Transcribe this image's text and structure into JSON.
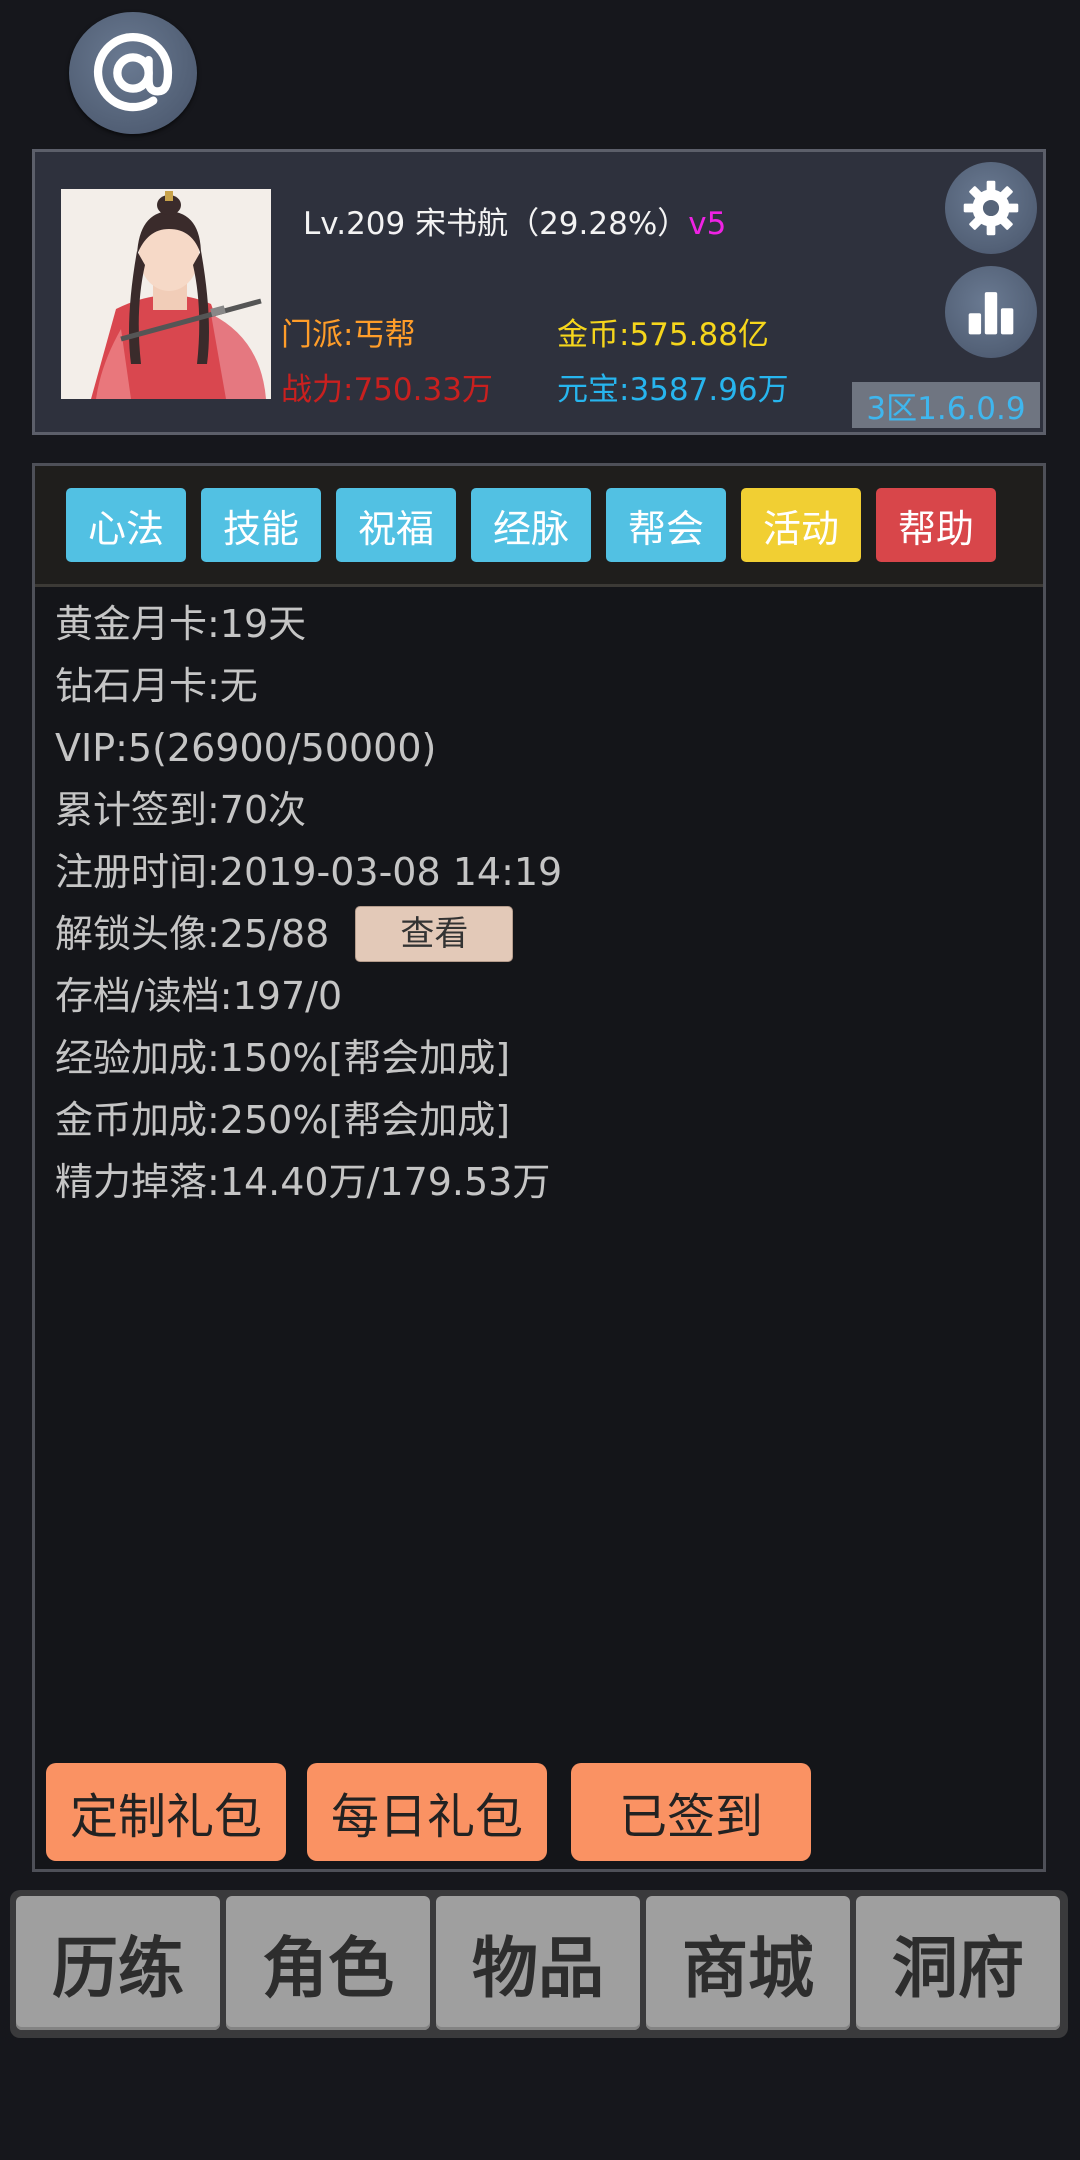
{
  "top": {
    "at_icon": "at-sign-icon"
  },
  "profile": {
    "level_line": "Lv.209 宋书航（29.28%）",
    "vip_badge": "v5",
    "sect": "门派:丐帮",
    "power": "战力:750.33万",
    "gold": "金币:575.88亿",
    "yuanbao": "元宝:3587.96万",
    "version": "3区1.6.0.9",
    "icons": {
      "settings": "gear-icon",
      "stats": "bar-chart-icon"
    }
  },
  "tabs": [
    {
      "label": "心法",
      "color": "#52c1e3"
    },
    {
      "label": "技能",
      "color": "#52c1e3"
    },
    {
      "label": "祝福",
      "color": "#52c1e3"
    },
    {
      "label": "经脉",
      "color": "#52c1e3"
    },
    {
      "label": "帮会",
      "color": "#52c1e3"
    },
    {
      "label": "活动",
      "color": "#f1cf33"
    },
    {
      "label": "帮助",
      "color": "#d8464a"
    }
  ],
  "info": {
    "gold_card": "黄金月卡:19天",
    "diamond_card": "钻石月卡:无",
    "vip": "VIP:5(26900/50000)",
    "signin": "累计签到:70次",
    "register": "注册时间:2019-03-08 14:19",
    "avatars": "解锁头像:25/88",
    "view_button": "查看",
    "saves": "存档/读档:197/0",
    "exp_bonus": "经验加成:150%[帮会加成]",
    "gold_bonus": "金币加成:250%[帮会加成]",
    "energy_drop": "精力掉落:14.40万/179.53万"
  },
  "gift_buttons": {
    "custom": "定制礼包",
    "daily": "每日礼包",
    "signed": "已签到"
  },
  "bottom_nav": [
    "历练",
    "角色",
    "物品",
    "商城",
    "洞府"
  ]
}
